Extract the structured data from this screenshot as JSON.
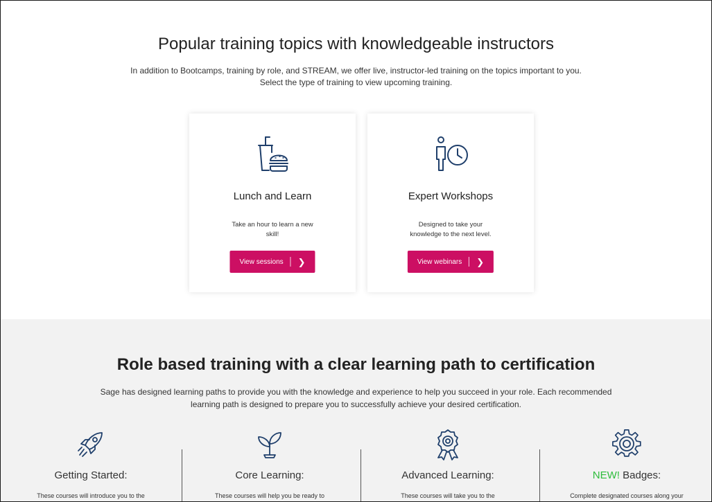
{
  "training_topics": {
    "title": "Popular training topics with knowledgeable instructors",
    "intro_line1": "In addition to Bootcamps, training by role, and STREAM, we offer live, instructor-led training on the topics important to you.",
    "intro_line2": "Select the type of training to view upcoming training.",
    "cards": [
      {
        "icon": "lunch-icon",
        "title": "Lunch and Learn",
        "desc_line1": "Take an hour to learn a new",
        "desc_line2": "skill!",
        "button_label": "View sessions",
        "button_chevron": "❯"
      },
      {
        "icon": "person-clock-icon",
        "title": "Expert Workshops",
        "desc_line1": "Designed to take your",
        "desc_line2": "knowledge to the next level.",
        "button_label": "View webinars",
        "button_chevron": "❯"
      }
    ]
  },
  "role_based": {
    "title": "Role based training with a clear learning path to certification",
    "intro_line1": "Sage has designed learning paths to provide you with the knowledge and experience to help you succeed in your role. Each recommended",
    "intro_line2": "learning path is designed to prepare you to successfully achieve your desired certification.",
    "paths": [
      {
        "icon": "rocket-icon",
        "title": "Getting Started:",
        "desc": "These courses will introduce you to the"
      },
      {
        "icon": "plant-icon",
        "title": "Core Learning:",
        "desc": "These courses will help you be ready to"
      },
      {
        "icon": "award-ribbon-icon",
        "title": "Advanced Learning:",
        "desc": "These courses will take you to the"
      },
      {
        "icon": "gear-badge-icon",
        "title_new": "NEW!",
        "title": " Badges:",
        "desc": "Complete designated courses along your"
      }
    ]
  },
  "colors": {
    "accent_button": "#cc0f63",
    "icon_stroke": "#1f3f6b",
    "new_badge": "#2ebd3c",
    "bottom_bg": "#f2f2f2"
  }
}
